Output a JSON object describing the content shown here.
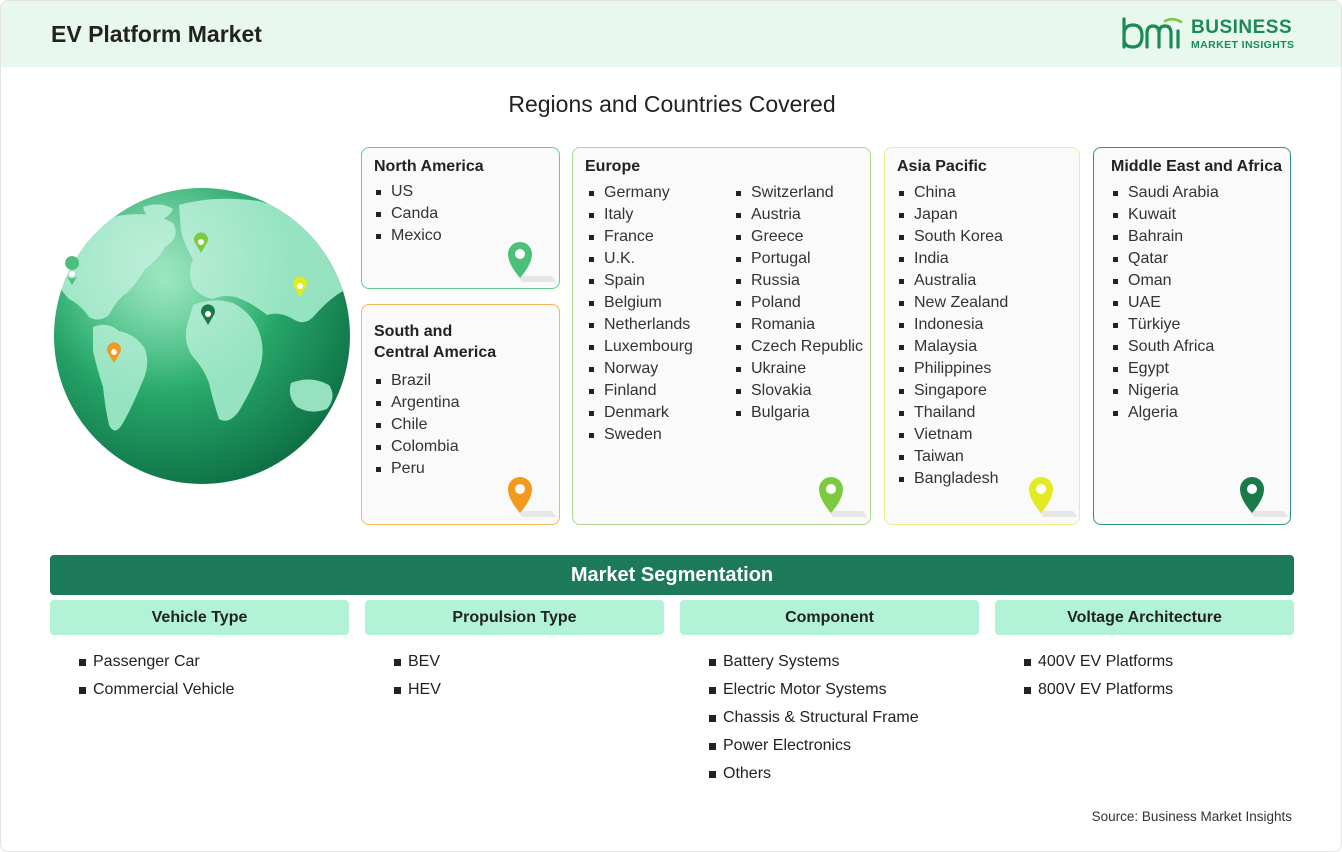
{
  "header": {
    "title": "EV Platform Market",
    "logo_line1": "BUSINESS",
    "logo_line2": "MARKET INSIGHTS",
    "logo_mark": "bmi"
  },
  "regions_title": "Regions and Countries Covered",
  "regions": [
    {
      "name": "North America",
      "color": "#5fcf88",
      "pin_color": "#4cc07a",
      "countries": [
        "US",
        "Canda",
        "Mexico"
      ]
    },
    {
      "name": "South and Central America",
      "name_line1": "South and",
      "name_line2": "Central America",
      "color": "#f5b55a",
      "pin_color": "#f39a1e",
      "countries": [
        "Brazil",
        "Argentina",
        "Chile",
        "Colombia",
        "Peru"
      ]
    },
    {
      "name": "Europe",
      "color": "#a9dc8a",
      "pin_color": "#7ccb3e",
      "countries_col1": [
        "Germany",
        "Italy",
        "France",
        "U.K.",
        "Spain",
        "Belgium",
        "Netherlands",
        "Luxembourg",
        "Norway",
        "Finland",
        "Denmark",
        "Sweden"
      ],
      "countries_col2": [
        "Switzerland",
        "Austria",
        "Greece",
        "Portugal",
        "Russia",
        "Poland",
        "Romania",
        "Czech Republic",
        "Ukraine",
        "Slovakia",
        "Bulgaria"
      ]
    },
    {
      "name": "Asia Pacific",
      "color": "#ecef8a",
      "pin_color": "#e3ea22",
      "countries": [
        "China",
        "Japan",
        "South Korea",
        "India",
        "Australia",
        "New Zealand",
        "Indonesia",
        "Malaysia",
        "Philippines",
        "Singapore",
        "Thailand",
        "Vietnam",
        "Taiwan",
        "Bangladesh"
      ]
    },
    {
      "name": "Middle East and Africa",
      "color": "#2f9b6a",
      "pin_color": "#1b7a4a",
      "countries": [
        "Saudi Arabia",
        "Kuwait",
        "Bahrain",
        "Qatar",
        "Oman",
        "UAE",
        "Türkiye",
        "South Africa",
        "Egypt",
        "Nigeria",
        "Algeria"
      ]
    }
  ],
  "segmentation": {
    "title": "Market Segmentation",
    "columns": [
      {
        "heading": "Vehicle Type",
        "items": [
          "Passenger Car",
          "Commercial Vehicle"
        ]
      },
      {
        "heading": "Propulsion Type",
        "items": [
          "BEV",
          "HEV"
        ]
      },
      {
        "heading": "Component",
        "items": [
          "Battery Systems",
          "Electric Motor Systems",
          "Chassis & Structural Frame",
          "Power Electronics",
          "Others"
        ]
      },
      {
        "heading": "Voltage Architecture",
        "items": [
          "400V EV Platforms",
          "800V EV Platforms"
        ]
      }
    ]
  },
  "source": "Source: Business Market Insights",
  "icons": [
    "globe-icon",
    "map-pin-icon",
    "bmi-logo-icon"
  ]
}
